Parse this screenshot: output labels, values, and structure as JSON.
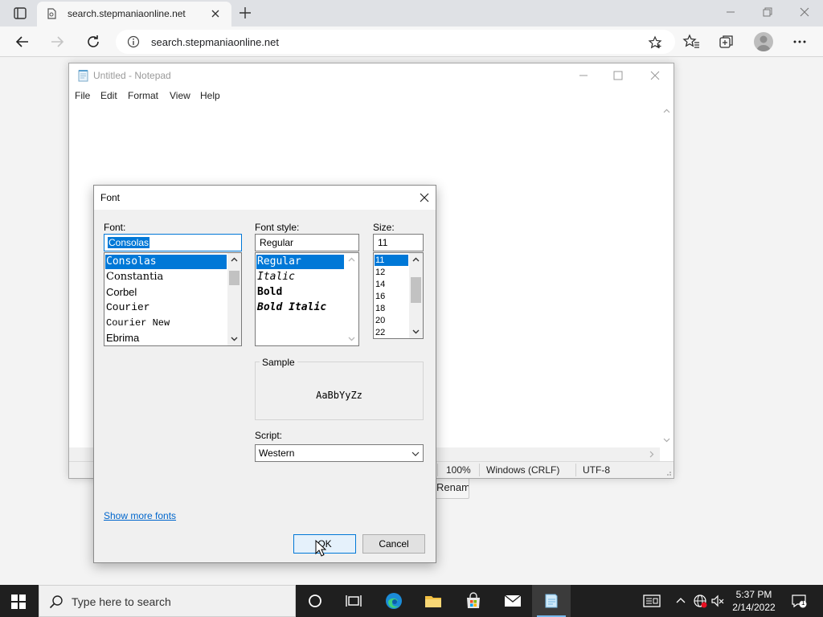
{
  "browser": {
    "tab_title": "search.stepmaniaonline.net",
    "address": "search.stepmaniaonline.net"
  },
  "page": {
    "partial_button_label": "Rename"
  },
  "notepad": {
    "title": "Untitled - Notepad",
    "menu": [
      "File",
      "Edit",
      "Format",
      "View",
      "Help"
    ],
    "status": {
      "zoom": "100%",
      "line_ending": "Windows (CRLF)",
      "encoding": "UTF-8"
    }
  },
  "font_dialog": {
    "title": "Font",
    "font_label": "Font:",
    "font_value": "Consolas",
    "fonts": [
      "Consolas",
      "Constantia",
      "Corbel",
      "Courier",
      "Courier New",
      "Ebrima"
    ],
    "selected_font": "Consolas",
    "style_label": "Font style:",
    "style_value": "Regular",
    "styles": [
      "Regular",
      "Italic",
      "Bold",
      "Bold Italic"
    ],
    "size_label": "Size:",
    "size_value": "11",
    "sizes": [
      "11",
      "12",
      "14",
      "16",
      "18",
      "20",
      "22"
    ],
    "sample_label": "Sample",
    "sample_text": "AaBbYyZz",
    "script_label": "Script:",
    "script_value": "Western",
    "show_more_fonts": "Show more fonts",
    "ok_label": "OK",
    "cancel_label": "Cancel"
  },
  "taskbar": {
    "search_placeholder": "Type here to search",
    "time": "5:37 PM",
    "date": "2/14/2022",
    "notification_count": "1"
  },
  "colors": {
    "accent": "#0078d7",
    "taskbar": "#1f1f1f",
    "link": "#0066cc"
  }
}
